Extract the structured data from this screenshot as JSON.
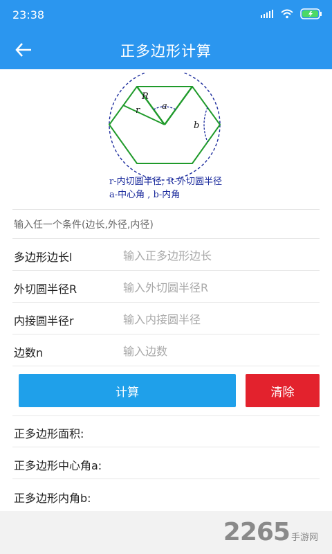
{
  "status": {
    "time": "23:38"
  },
  "header": {
    "title": "正多边形计算"
  },
  "diagram": {
    "labels": {
      "R": "R",
      "r": "r",
      "a": "a",
      "b": "b"
    },
    "legend_line1": "r-内切圆半径, R-外切圆半径",
    "legend_line2": "a-中心角  ,  b-内角"
  },
  "form": {
    "hint": "输入任一个条件(边长,外径,内径)",
    "fields": [
      {
        "label": "多边形边长l",
        "placeholder": "输入正多边形边长",
        "value": ""
      },
      {
        "label": "外切圆半径R",
        "placeholder": "输入外切圆半径R",
        "value": ""
      },
      {
        "label": "内接圆半径r",
        "placeholder": "输入内接圆半径",
        "value": ""
      },
      {
        "label": "边数n",
        "placeholder": "输入边数",
        "value": ""
      }
    ]
  },
  "buttons": {
    "calculate": "计算",
    "clear": "清除"
  },
  "results": {
    "area": "正多边形面积:",
    "center_angle": "正多边形中心角a:",
    "interior_angle": "正多边形内角b:"
  },
  "watermark": {
    "number": "2265",
    "text": "手游网"
  },
  "colors": {
    "primary": "#2b96ef",
    "button_blue": "#1fa0ea",
    "button_red": "#e3222d"
  }
}
